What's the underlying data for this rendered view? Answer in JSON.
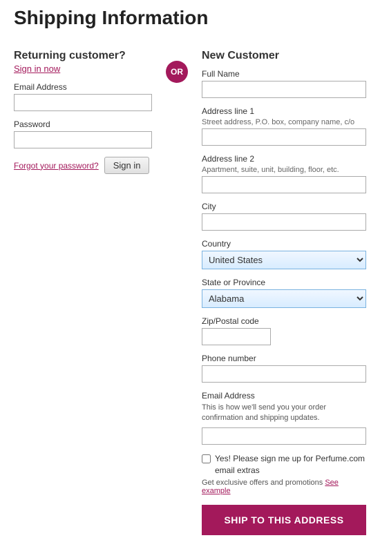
{
  "page": {
    "title": "Shipping Information"
  },
  "returning": {
    "title": "Returning customer?",
    "sign_in_link": "Sign in now",
    "email_label": "Email Address",
    "password_label": "Password",
    "forgot_link": "Forgot your password?",
    "signin_btn": "Sign in"
  },
  "or_label": "OR",
  "new_customer": {
    "title": "New Customer",
    "full_name_label": "Full Name",
    "address1_label": "Address line 1",
    "address1_sublabel": "Street address, P.O. box, company name, c/o",
    "address2_label": "Address line 2",
    "address2_sublabel": "Apartment, suite, unit, building, floor, etc.",
    "city_label": "City",
    "country_label": "Country",
    "country_value": "United States",
    "state_label": "State or Province",
    "state_value": "Alabama",
    "zip_label": "Zip/Postal code",
    "phone_label": "Phone number",
    "email_label": "Email Address",
    "email_note": "This is how we'll send you your order confirmation and shipping updates.",
    "checkbox_label": "Yes! Please sign me up for Perfume.com email extras",
    "extras_note": "Get exclusive offers and promotions",
    "see_example": "See example",
    "ship_btn": "SHIP TO THIS ADDRESS"
  }
}
